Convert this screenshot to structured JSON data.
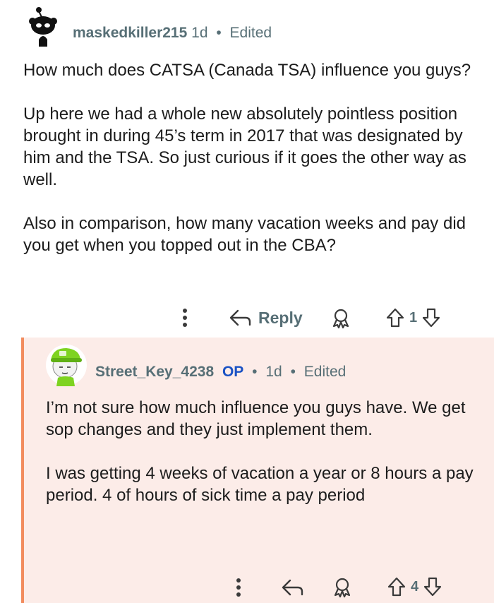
{
  "post": {
    "username": "maskedkiller215",
    "age": "1d",
    "separator": "•",
    "edited": "Edited",
    "paragraphs": [
      "How much does CATSA (Canada TSA) influence you guys?",
      "Up here we had a whole new absolutely pointless position brought in during 45’s term in 2017 that was designated by him and the TSA. So just curious if it goes the other way as well.",
      "Also in comparison, how many vacation weeks and pay did you get when you topped out in the CBA?"
    ],
    "reply_label": "Reply",
    "vote_count": "1"
  },
  "reply": {
    "username": "Street_Key_4238",
    "op_badge": "OP",
    "age": "1d",
    "separator": "•",
    "edited": "Edited",
    "paragraphs": [
      "I’m not sure how much influence you guys have. We get sop changes and they just implement them.",
      "I was getting 4 weeks of vacation a year or 8 hours a pay period. 4 of hours of sick time a pay period"
    ],
    "vote_count": "4"
  },
  "colors": {
    "meta_text": "#576f76",
    "op_badge": "#1a52c4",
    "reply_background": "#fcece8",
    "reply_border": "#f28c5e"
  },
  "icons": [
    "snoo-avatar",
    "more-dots-icon",
    "reply-arrow-icon",
    "award-icon",
    "upvote-icon",
    "downvote-icon",
    "green-hat-avatar"
  ]
}
